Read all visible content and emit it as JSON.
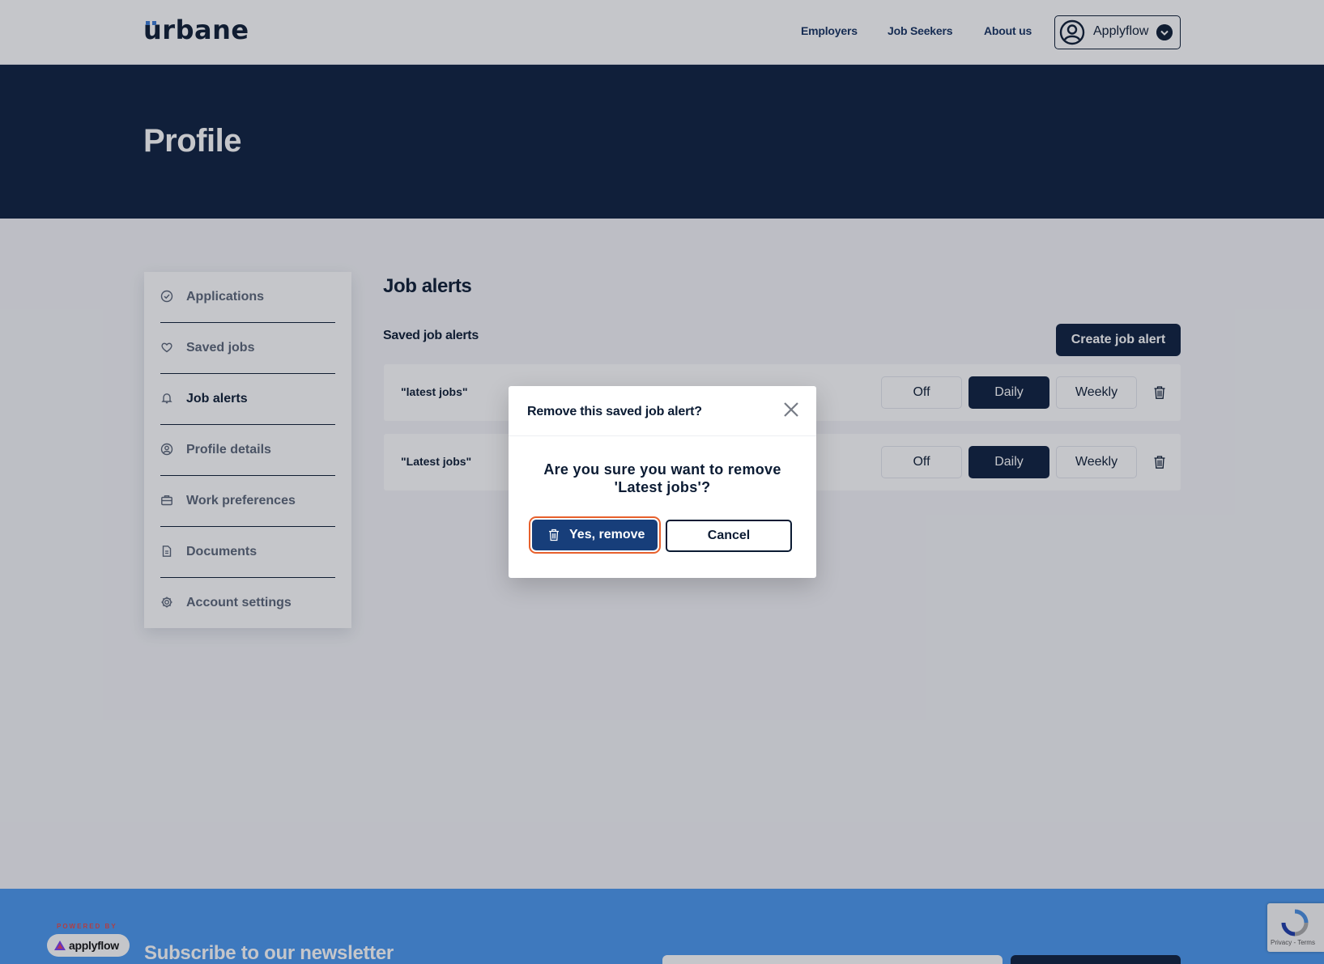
{
  "header": {
    "logo": "urbane",
    "nav": [
      "Employers",
      "Job Seekers",
      "About us"
    ],
    "account": {
      "name": "Applyflow",
      "avatar_icon": "user-circle-icon",
      "menu_icon": "chevron-down-icon"
    }
  },
  "hero": {
    "title": "Profile"
  },
  "sidebar": {
    "items": [
      {
        "label": "Applications",
        "icon": "check-circle-icon",
        "active": false
      },
      {
        "label": "Saved jobs",
        "icon": "heart-icon",
        "active": false
      },
      {
        "label": "Job alerts",
        "icon": "bell-icon",
        "active": true
      },
      {
        "label": "Profile details",
        "icon": "user-circle-icon",
        "active": false
      },
      {
        "label": "Work preferences",
        "icon": "briefcase-icon",
        "active": false
      },
      {
        "label": "Documents",
        "icon": "document-icon",
        "active": false
      },
      {
        "label": "Account settings",
        "icon": "gear-icon",
        "active": false
      }
    ]
  },
  "main": {
    "title": "Job alerts",
    "subtitle": "Saved job alerts",
    "create_button": "Create job alert",
    "alerts": [
      {
        "query": "\"latest jobs\"",
        "frequency_options": [
          "Off",
          "Daily",
          "Weekly"
        ],
        "selected": "Daily"
      },
      {
        "query": "\"Latest jobs\"",
        "frequency_options": [
          "Off",
          "Daily",
          "Weekly"
        ],
        "selected": "Daily"
      }
    ]
  },
  "modal": {
    "title": "Remove this saved job alert?",
    "message": "Are you sure you want to remove 'Latest jobs'?",
    "confirm_label": "Yes, remove",
    "cancel_label": "Cancel"
  },
  "footer": {
    "powered_by": "POWERED BY",
    "badge": "applyflow",
    "newsletter_title": "Subscribe to our newsletter",
    "recaptcha": "Privacy - Terms"
  },
  "colors": {
    "navy": "#0b1e3d",
    "confirm_button": "#173e7a",
    "focus_ring": "#e7602c",
    "footer_blue": "#4a98ef"
  }
}
